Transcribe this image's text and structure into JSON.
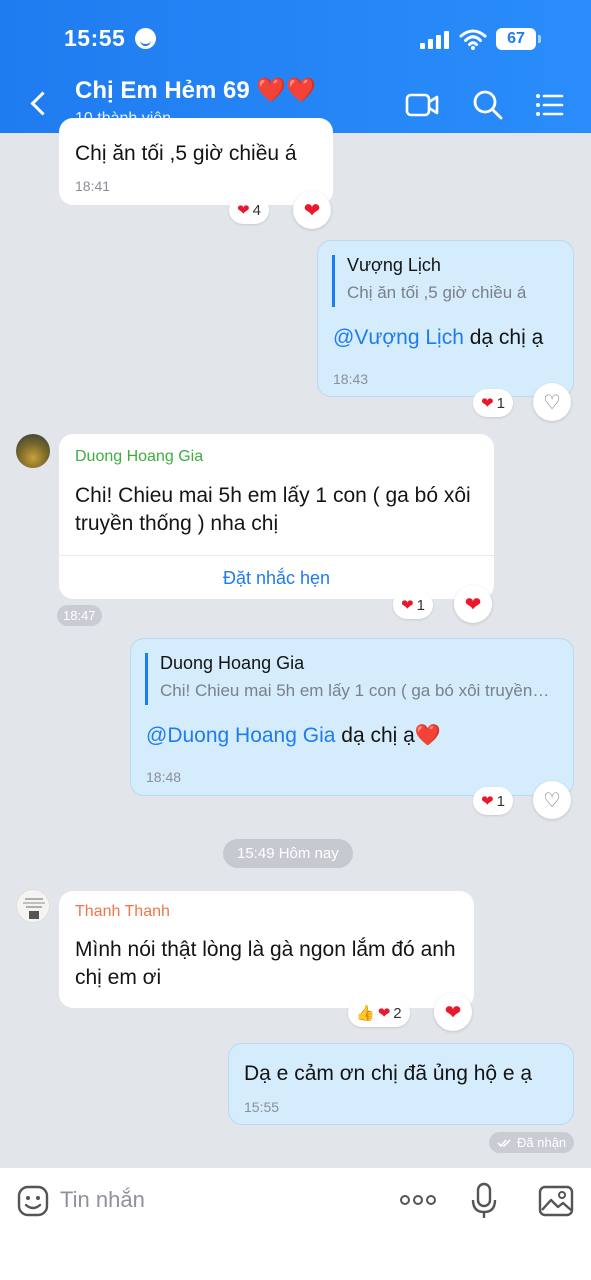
{
  "status_bar": {
    "time": "15:55",
    "battery": "67"
  },
  "header": {
    "title": "Chị Em Hẻm 69 ❤️❤️",
    "subtitle": "10 thành viên"
  },
  "messages": [
    {
      "text": "Chị ăn tối ,5 giờ chiều á",
      "time": "18:41",
      "reaction_count": "4"
    },
    {
      "quote_name": "Vượng Lịch",
      "quote_text": "Chị ăn tối ,5 giờ chiều á",
      "mention": "@Vượng Lịch",
      "text": " dạ chị ạ",
      "time": "18:43",
      "reaction_count": "1"
    },
    {
      "sender": "Duong Hoang Gia",
      "text": "Chi! Chieu mai 5h em lấy 1 con ( ga bó xôi truyền thống ) nha chị",
      "action": "Đặt nhắc hẹn",
      "time": "18:47",
      "reaction_count": "1"
    },
    {
      "quote_name": "Duong Hoang Gia",
      "quote_text": "Chi! Chieu mai 5h em lấy 1 con ( ga bó xôi truyền thống ) nha chị",
      "mention": "@Duong Hoang Gia",
      "text": " dạ chị ạ❤️",
      "time": "18:48",
      "reaction_count": "1"
    },
    {
      "sender": "Thanh Thanh",
      "text": "Mình nói thật lòng là gà ngon lắm đó anh chị em ơi",
      "reaction_count": "2"
    },
    {
      "text": "Dạ e cảm ơn chị đã ủng hộ e ạ",
      "time": "15:55",
      "status": "Đã nhận"
    }
  ],
  "day_separator": "15:49 Hôm nay",
  "composer": {
    "placeholder": "Tin nhắn"
  },
  "colors": {
    "primary": "#1f7cf0",
    "heart": "#e8192c",
    "sender_green": "#3fae3f",
    "sender_orange": "#f0764a"
  }
}
